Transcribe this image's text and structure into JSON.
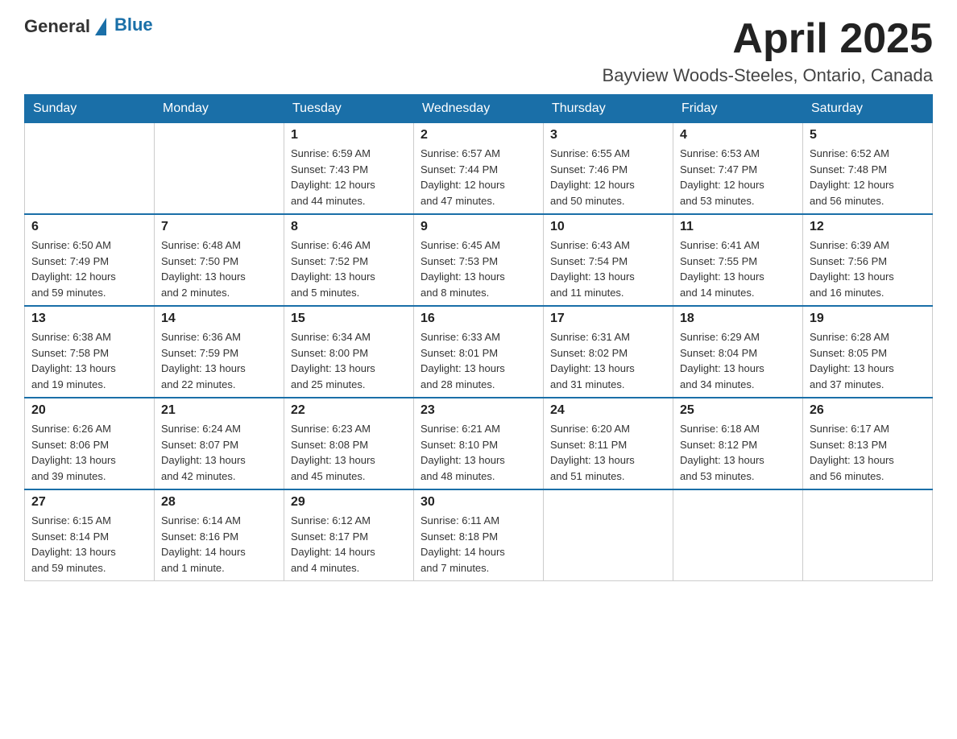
{
  "header": {
    "logo_general": "General",
    "logo_blue": "Blue",
    "month": "April 2025",
    "location": "Bayview Woods-Steeles, Ontario, Canada"
  },
  "weekdays": [
    "Sunday",
    "Monday",
    "Tuesday",
    "Wednesday",
    "Thursday",
    "Friday",
    "Saturday"
  ],
  "weeks": [
    [
      {
        "day": "",
        "info": ""
      },
      {
        "day": "",
        "info": ""
      },
      {
        "day": "1",
        "info": "Sunrise: 6:59 AM\nSunset: 7:43 PM\nDaylight: 12 hours\nand 44 minutes."
      },
      {
        "day": "2",
        "info": "Sunrise: 6:57 AM\nSunset: 7:44 PM\nDaylight: 12 hours\nand 47 minutes."
      },
      {
        "day": "3",
        "info": "Sunrise: 6:55 AM\nSunset: 7:46 PM\nDaylight: 12 hours\nand 50 minutes."
      },
      {
        "day": "4",
        "info": "Sunrise: 6:53 AM\nSunset: 7:47 PM\nDaylight: 12 hours\nand 53 minutes."
      },
      {
        "day": "5",
        "info": "Sunrise: 6:52 AM\nSunset: 7:48 PM\nDaylight: 12 hours\nand 56 minutes."
      }
    ],
    [
      {
        "day": "6",
        "info": "Sunrise: 6:50 AM\nSunset: 7:49 PM\nDaylight: 12 hours\nand 59 minutes."
      },
      {
        "day": "7",
        "info": "Sunrise: 6:48 AM\nSunset: 7:50 PM\nDaylight: 13 hours\nand 2 minutes."
      },
      {
        "day": "8",
        "info": "Sunrise: 6:46 AM\nSunset: 7:52 PM\nDaylight: 13 hours\nand 5 minutes."
      },
      {
        "day": "9",
        "info": "Sunrise: 6:45 AM\nSunset: 7:53 PM\nDaylight: 13 hours\nand 8 minutes."
      },
      {
        "day": "10",
        "info": "Sunrise: 6:43 AM\nSunset: 7:54 PM\nDaylight: 13 hours\nand 11 minutes."
      },
      {
        "day": "11",
        "info": "Sunrise: 6:41 AM\nSunset: 7:55 PM\nDaylight: 13 hours\nand 14 minutes."
      },
      {
        "day": "12",
        "info": "Sunrise: 6:39 AM\nSunset: 7:56 PM\nDaylight: 13 hours\nand 16 minutes."
      }
    ],
    [
      {
        "day": "13",
        "info": "Sunrise: 6:38 AM\nSunset: 7:58 PM\nDaylight: 13 hours\nand 19 minutes."
      },
      {
        "day": "14",
        "info": "Sunrise: 6:36 AM\nSunset: 7:59 PM\nDaylight: 13 hours\nand 22 minutes."
      },
      {
        "day": "15",
        "info": "Sunrise: 6:34 AM\nSunset: 8:00 PM\nDaylight: 13 hours\nand 25 minutes."
      },
      {
        "day": "16",
        "info": "Sunrise: 6:33 AM\nSunset: 8:01 PM\nDaylight: 13 hours\nand 28 minutes."
      },
      {
        "day": "17",
        "info": "Sunrise: 6:31 AM\nSunset: 8:02 PM\nDaylight: 13 hours\nand 31 minutes."
      },
      {
        "day": "18",
        "info": "Sunrise: 6:29 AM\nSunset: 8:04 PM\nDaylight: 13 hours\nand 34 minutes."
      },
      {
        "day": "19",
        "info": "Sunrise: 6:28 AM\nSunset: 8:05 PM\nDaylight: 13 hours\nand 37 minutes."
      }
    ],
    [
      {
        "day": "20",
        "info": "Sunrise: 6:26 AM\nSunset: 8:06 PM\nDaylight: 13 hours\nand 39 minutes."
      },
      {
        "day": "21",
        "info": "Sunrise: 6:24 AM\nSunset: 8:07 PM\nDaylight: 13 hours\nand 42 minutes."
      },
      {
        "day": "22",
        "info": "Sunrise: 6:23 AM\nSunset: 8:08 PM\nDaylight: 13 hours\nand 45 minutes."
      },
      {
        "day": "23",
        "info": "Sunrise: 6:21 AM\nSunset: 8:10 PM\nDaylight: 13 hours\nand 48 minutes."
      },
      {
        "day": "24",
        "info": "Sunrise: 6:20 AM\nSunset: 8:11 PM\nDaylight: 13 hours\nand 51 minutes."
      },
      {
        "day": "25",
        "info": "Sunrise: 6:18 AM\nSunset: 8:12 PM\nDaylight: 13 hours\nand 53 minutes."
      },
      {
        "day": "26",
        "info": "Sunrise: 6:17 AM\nSunset: 8:13 PM\nDaylight: 13 hours\nand 56 minutes."
      }
    ],
    [
      {
        "day": "27",
        "info": "Sunrise: 6:15 AM\nSunset: 8:14 PM\nDaylight: 13 hours\nand 59 minutes."
      },
      {
        "day": "28",
        "info": "Sunrise: 6:14 AM\nSunset: 8:16 PM\nDaylight: 14 hours\nand 1 minute."
      },
      {
        "day": "29",
        "info": "Sunrise: 6:12 AM\nSunset: 8:17 PM\nDaylight: 14 hours\nand 4 minutes."
      },
      {
        "day": "30",
        "info": "Sunrise: 6:11 AM\nSunset: 8:18 PM\nDaylight: 14 hours\nand 7 minutes."
      },
      {
        "day": "",
        "info": ""
      },
      {
        "day": "",
        "info": ""
      },
      {
        "day": "",
        "info": ""
      }
    ]
  ]
}
